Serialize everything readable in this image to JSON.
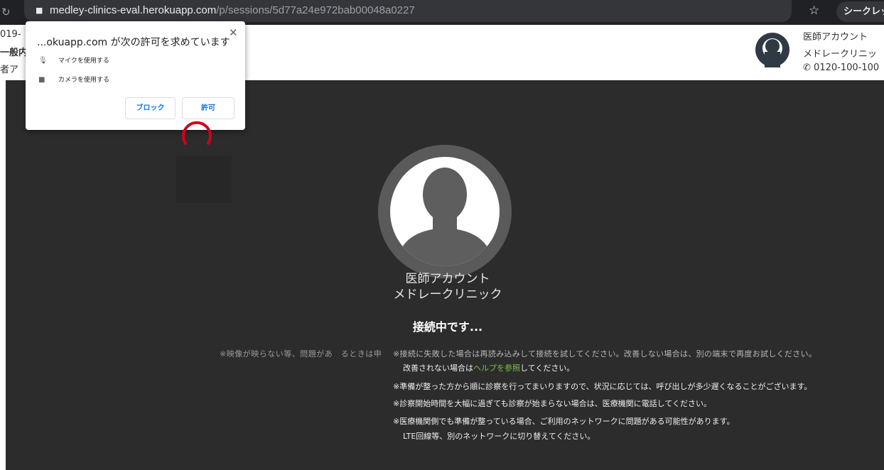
{
  "browser": {
    "url_host": "medley-clinics-eval.herokuapp.com",
    "url_path": "/p/sessions/5d77a24e972bab00048a0227",
    "profile_label": "シークレッ"
  },
  "header": {
    "left_lines": [
      "019-",
      "一般内",
      "者ア"
    ],
    "doctor_title": "医師アカウント",
    "clinic": "メドレークリニッ",
    "phone": "0120-100-100"
  },
  "permission": {
    "title": "...okuapp.com が次の許可を求めています",
    "items": [
      "マイクを使用する",
      "カメラを使用する"
    ],
    "block_label": "ブロック",
    "allow_label": "許可"
  },
  "video": {
    "doctor_name": "医師アカウント",
    "clinic_name": "メドレークリニック",
    "status": "接続中です...",
    "overlap_text_a": "※映像が映らない等、問題があ　るときは申",
    "overlap_text_b": "※接続に失敗した場合は再読み込みして接続を試してください。改善しない場合は、別の端末で再度お試しください。",
    "help_prefix": "改善されない場合は",
    "help_link": "ヘルプを参照",
    "help_suffix": "してください。",
    "notices": [
      "※準備が整った方から順に診察を行ってまいりますので、状況に応じては、呼び出しが多少遅くなることがございます。",
      "※診察開始時間を大幅に過ぎても診察が始まらない場合は、医療機関に電話してください。",
      "※医療機関側でも準備が整っている場合、ご利用のネットワークに問題がある可能性があります。",
      "LTE回線等、別のネットワークに切り替えてください。"
    ]
  },
  "colors": {
    "video_bg": "#2c2c2c",
    "link_green": "#7bc142",
    "spinner_red": "#d0021b",
    "button_blue": "#1a73e8"
  }
}
